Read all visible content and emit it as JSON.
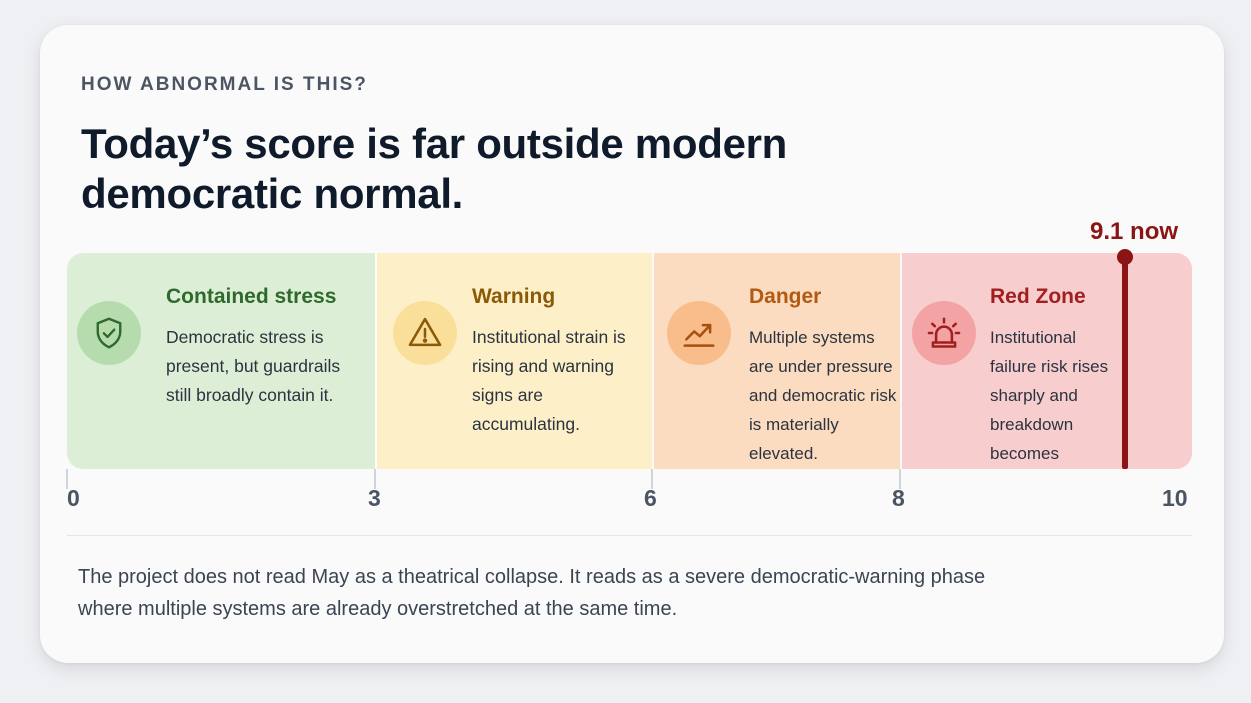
{
  "eyebrow": "HOW ABNORMAL IS THIS?",
  "headline": "Today’s score is far outside modern democratic normal.",
  "marker": {
    "value": 9.1,
    "label": "9.1 now",
    "color": "#8b1414"
  },
  "scale": {
    "min": 0,
    "max": 10,
    "ticks": [
      "0",
      "3",
      "6",
      "8",
      "10"
    ]
  },
  "zones": [
    {
      "title": "Contained stress",
      "description": "Democratic stress is present, but guardrails still broadly contain it.",
      "icon": "shield-check-icon",
      "color": "#dcefd6"
    },
    {
      "title": "Warning",
      "description": "Institutional strain is rising and warning signs are accumulating.",
      "icon": "warning-triangle-icon",
      "color": "#fdf0c8"
    },
    {
      "title": "Danger",
      "description": "Multiple systems are under pressure and democratic risk is materially elevated.",
      "icon": "trend-up-icon",
      "color": "#fbdcc0"
    },
    {
      "title": "Red Zone",
      "description": "Institutional failure risk rises sharply and breakdown becomes plausible.",
      "icon": "alarm-siren-icon",
      "color": "#f8cdcd"
    }
  ],
  "footnote": "The project does not read May as a theatrical collapse. It reads as a severe democratic-warning phase where multiple systems are already overstretched at the same time."
}
